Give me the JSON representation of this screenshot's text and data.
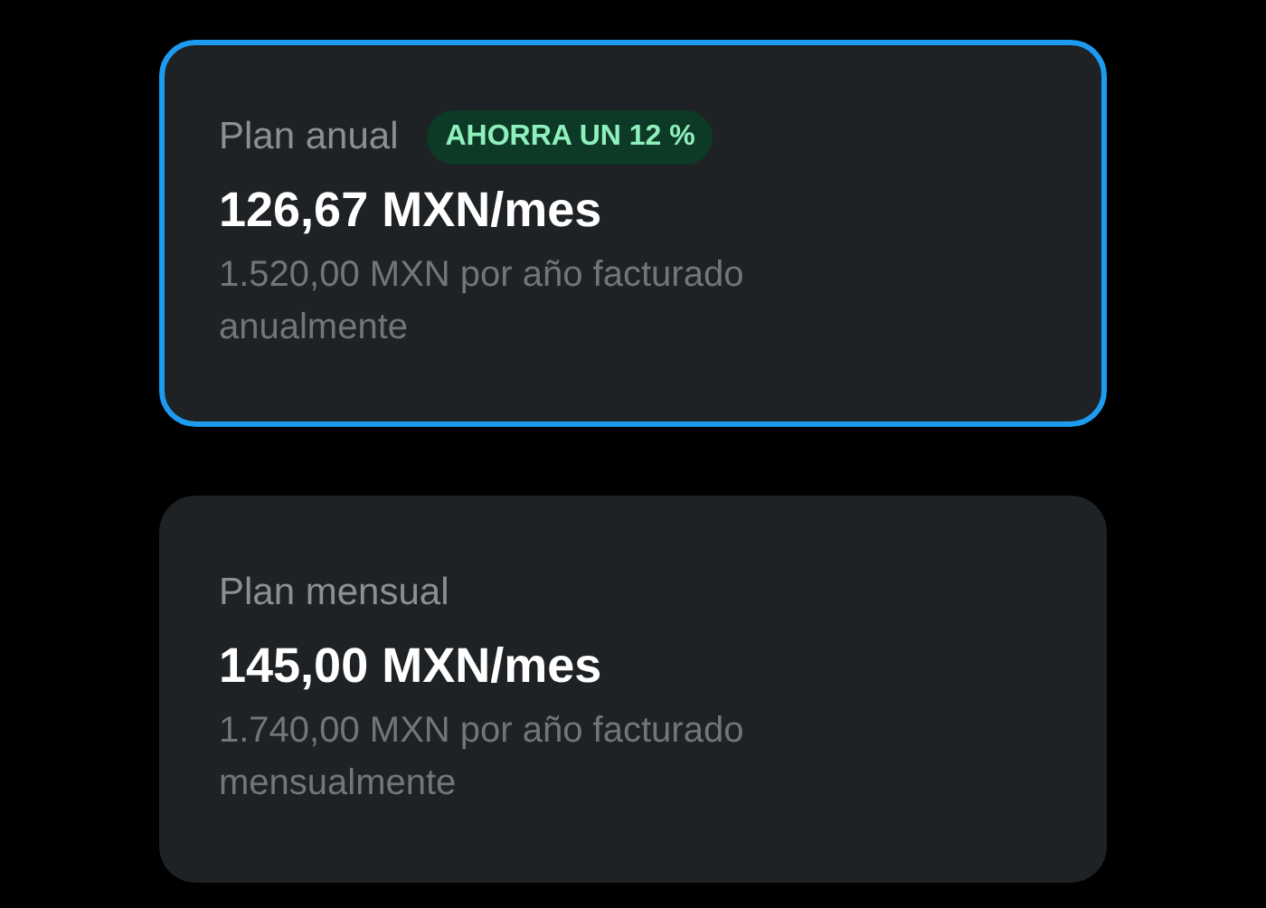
{
  "plans": [
    {
      "name": "Plan anual",
      "badge": "AHORRA UN 12 %",
      "price": "126,67 MXN/mes",
      "description": "1.520,00 MXN por año facturado anualmente",
      "selected": true
    },
    {
      "name": "Plan mensual",
      "price": "145,00 MXN/mes",
      "description": "1.740,00 MXN por año facturado mensualmente",
      "selected": false
    }
  ]
}
